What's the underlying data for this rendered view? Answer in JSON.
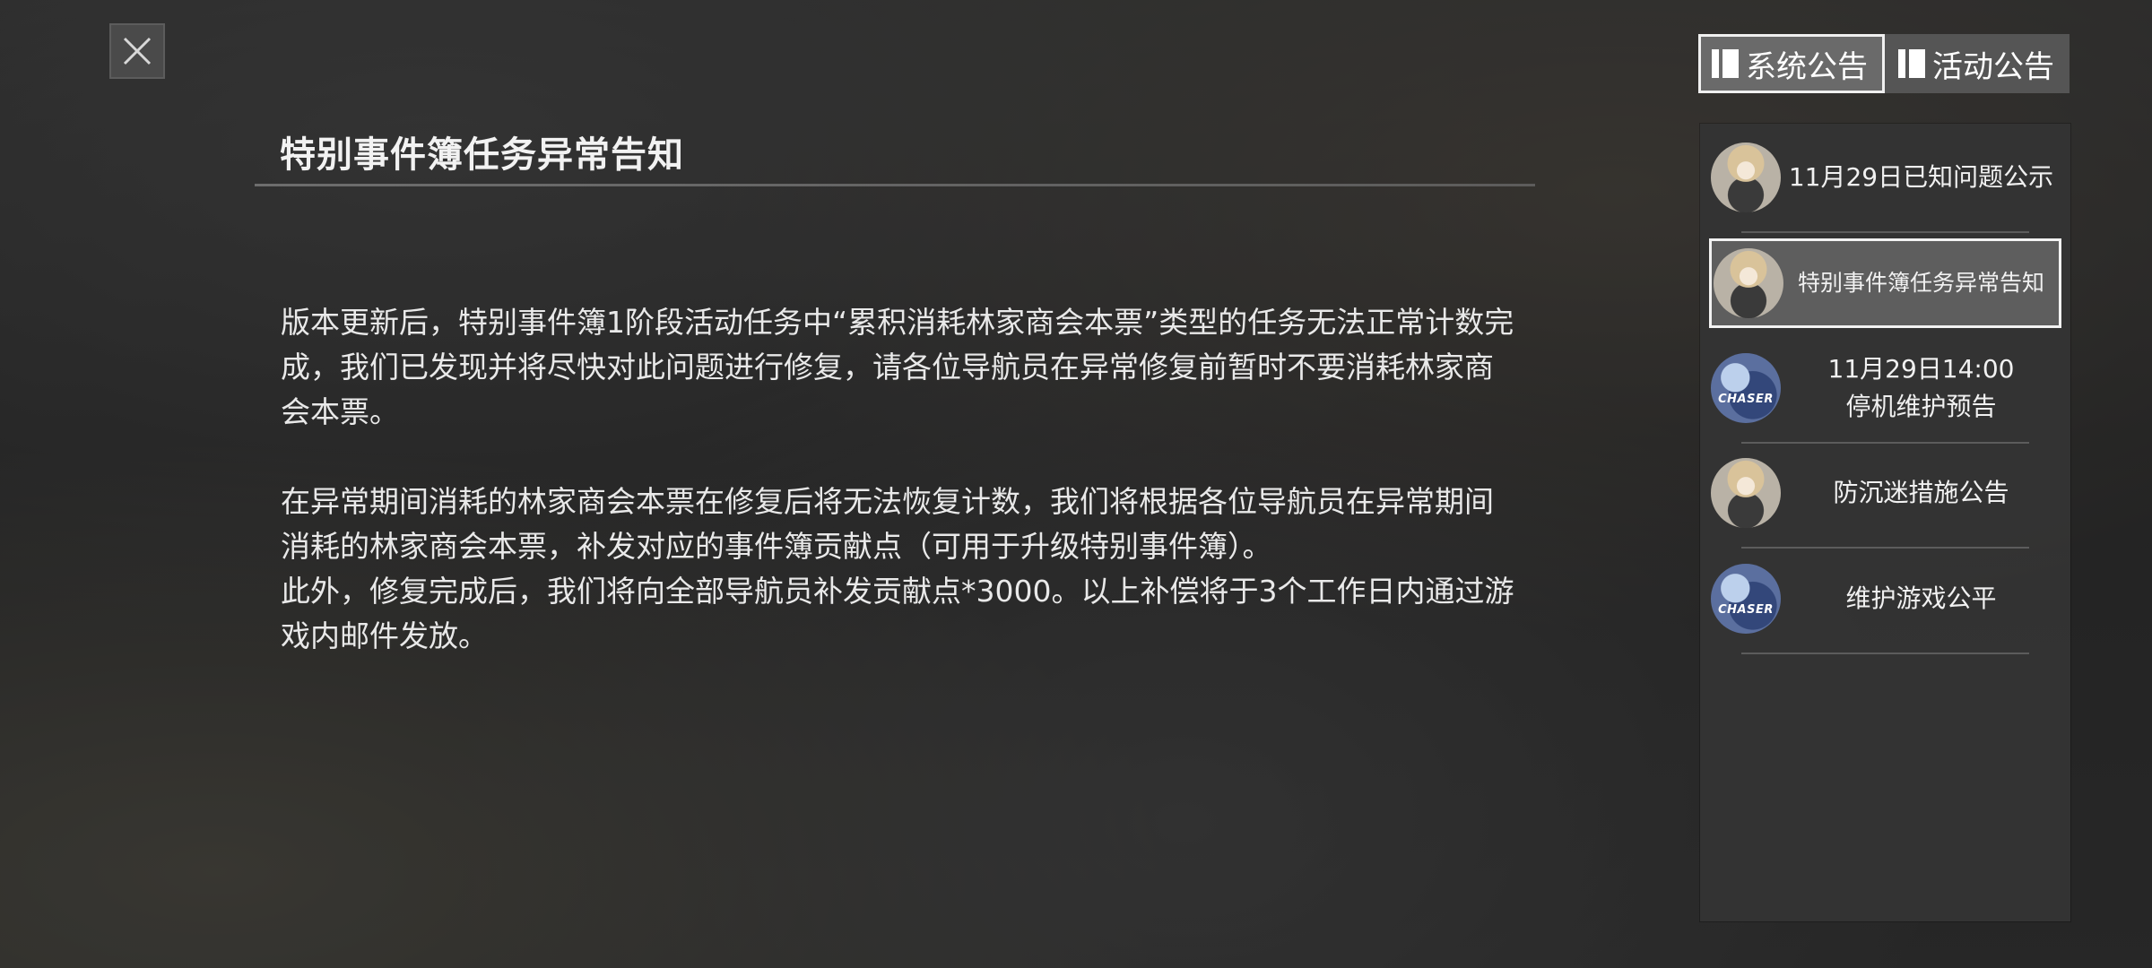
{
  "tabs": [
    {
      "label": "系统公告",
      "active": true
    },
    {
      "label": "活动公告",
      "active": false
    }
  ],
  "notice": {
    "title": "特别事件簿任务异常告知",
    "paragraphs": [
      "版本更新后，特别事件簿1阶段活动任务中“累积消耗林家商会本票”类型的任务无法正常计数完成，我们已发现并将尽快对此问题进行修复，请各位导航员在异常修复前暂时不要消耗林家商会本票。",
      "在异常期间消耗的林家商会本票在修复后将无法恢复计数，我们将根据各位导航员在异常期间消耗的林家商会本票，补发对应的事件簿贡献点（可用于升级特别事件簿）。",
      "此外，修复完成后，我们将向全部导航员补发贡献点*3000。以上补偿将于3个工作日内通过游戏内邮件发放。"
    ]
  },
  "announcements": [
    {
      "line1": "11月29日已知问题公示",
      "line2": "",
      "avatar": "girl-avatar",
      "selected": false
    },
    {
      "line1": "特别事件簿任务异常告知",
      "line2": "",
      "avatar": "girl-avatar",
      "selected": true
    },
    {
      "line1": "11月29日14:00",
      "line2": "停机维护预告",
      "avatar": "chaser-logo",
      "selected": false
    },
    {
      "line1": "防沉迷措施公告",
      "line2": "",
      "avatar": "girl-avatar",
      "selected": false
    },
    {
      "line1": "维护游戏公平",
      "line2": "",
      "avatar": "chaser-logo",
      "selected": false
    }
  ],
  "logo_text": "CHASER",
  "icons": {
    "close": "close-icon",
    "tab": "book-icon"
  },
  "colors": {
    "text": "#f2f2f2",
    "panel": "#343434",
    "selected_border": "#f2f2f2"
  }
}
